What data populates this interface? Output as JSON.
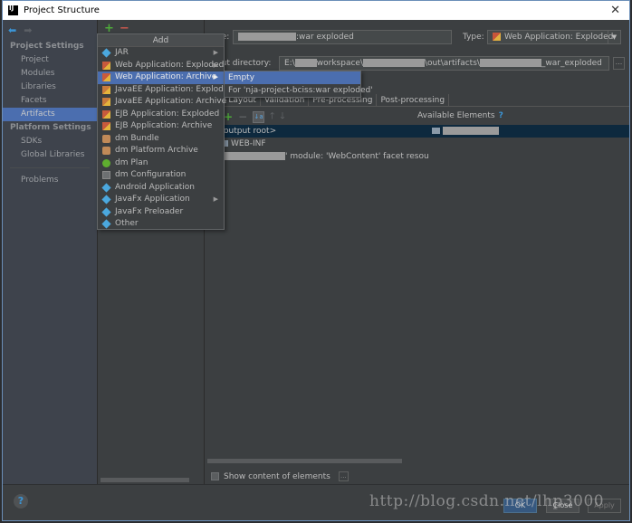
{
  "window": {
    "title": "Project Structure",
    "close_glyph": "✕"
  },
  "nav": {
    "back_glyph": "⬅",
    "forward_glyph": "➡",
    "groups": [
      {
        "label": "Project Settings",
        "items": [
          "Project",
          "Modules",
          "Libraries",
          "Facets",
          "Artifacts"
        ]
      },
      {
        "label": "Platform Settings",
        "items": [
          "SDKs",
          "Global Libraries"
        ]
      }
    ],
    "selected": "Artifacts",
    "problems": "Problems"
  },
  "mid_toolbar": {
    "add_glyph": "+",
    "remove_glyph": "−"
  },
  "popup": {
    "title": "Add",
    "items": [
      {
        "label": "JAR",
        "icon": "jar-icon",
        "submenu": true
      },
      {
        "label": "Web Application: Exploded",
        "icon": "war-icon",
        "submenu": true
      },
      {
        "label": "Web Application: Archive",
        "icon": "war-icon",
        "submenu": true,
        "highlighted": true
      },
      {
        "label": "JavaEE Application: Exploded",
        "icon": "ear-icon",
        "submenu": false
      },
      {
        "label": "JavaEE Application: Archive",
        "icon": "ear-icon",
        "submenu": false
      },
      {
        "label": "EJB Application: Exploded",
        "icon": "ejb-icon",
        "submenu": false
      },
      {
        "label": "EJB Application: Archive",
        "icon": "ejb-icon",
        "submenu": false
      },
      {
        "label": "dm Bundle",
        "icon": "bundle-icon",
        "submenu": false
      },
      {
        "label": "dm Platform Archive",
        "icon": "bundle-icon",
        "submenu": false
      },
      {
        "label": "dm Plan",
        "icon": "plan-icon",
        "submenu": false
      },
      {
        "label": "dm Configuration",
        "icon": "config-icon",
        "submenu": false
      },
      {
        "label": "Android Application",
        "icon": "android-icon",
        "submenu": false
      },
      {
        "label": "JavaFx Application",
        "icon": "javafx-icon",
        "submenu": true
      },
      {
        "label": "JavaFx Preloader",
        "icon": "javafx-icon",
        "submenu": false
      },
      {
        "label": "Other",
        "icon": "other-icon",
        "submenu": false
      }
    ],
    "arrow_glyph": "▶"
  },
  "submenu": {
    "items": [
      "Empty",
      "For 'nja-project-bciss:war exploded'"
    ],
    "highlighted": 0
  },
  "artifact": {
    "name_label": "Name:",
    "name_label_visible": "ne:",
    "name_suffix": ":war exploded",
    "type_label": "Type:",
    "type_value": "Web Application: Exploded",
    "dropdown_glyph": "▼",
    "output_label_visible": "put directory:",
    "output_prefix": "E:\\",
    "output_mid1": "workspace\\",
    "output_mid2": "\\out\\artifacts\\",
    "output_suffix": "_war_exploded",
    "browse_glyph": "..."
  },
  "tabs": [
    "Output Layout",
    "Validation",
    "Pre-processing",
    "Post-processing"
  ],
  "tabs_visible": [
    "tput Layout",
    "Validation",
    "Pre-processing",
    "Post-processing"
  ],
  "layout_toolbar": {
    "add": "+",
    "remove": "−",
    "sort": "↓a z",
    "up": "🡑",
    "down": "🡓"
  },
  "output_tree": [
    {
      "label": "output root>",
      "selected": true
    },
    {
      "label": "WEB-INF",
      "selected": false
    },
    {
      "label": "' module: 'WebContent' facet resou",
      "selected": false
    }
  ],
  "available": {
    "label": "Available Elements",
    "help": "?"
  },
  "show_content": {
    "label": "Show content of elements",
    "checked": false,
    "more_glyph": "..."
  },
  "footer": {
    "help": "?",
    "ok": "OK",
    "close": "Close",
    "apply": "Apply",
    "watermark": "http://blog.csdn.net/lhp3000"
  }
}
